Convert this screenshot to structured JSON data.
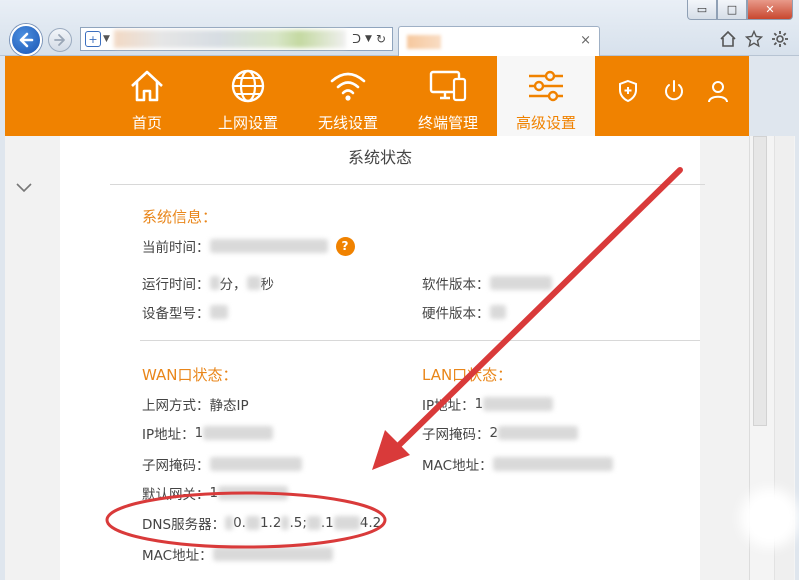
{
  "browser": {
    "window_buttons": {
      "minimize": "▭",
      "maximize": "□",
      "close": "✕"
    },
    "tab_close": "×",
    "icons": [
      "home-icon",
      "star-icon",
      "gear-icon"
    ]
  },
  "nav": {
    "items": [
      {
        "label": "首页",
        "icon": "home-icon"
      },
      {
        "label": "上网设置",
        "icon": "globe-icon"
      },
      {
        "label": "无线设置",
        "icon": "wifi-icon"
      },
      {
        "label": "终端管理",
        "icon": "devices-icon"
      },
      {
        "label": "高级设置",
        "icon": "sliders-icon",
        "active": true
      }
    ],
    "right_icons": [
      "shield-icon",
      "power-icon",
      "user-icon"
    ],
    "color": "#f08200"
  },
  "page": {
    "title": "系统状态",
    "system_info": {
      "title": "系统信息：",
      "current_time_label": "当前时间：",
      "help": "?",
      "uptime_label": "运行时间：",
      "uptime_min": "分，",
      "uptime_sec": "秒",
      "software_version_label": "软件版本：",
      "device_model_label": "设备型号：",
      "hardware_version_label": "硬件版本："
    },
    "wan": {
      "title": "WAN口状态：",
      "conn_type_label": "上网方式：",
      "conn_type_value": "静态IP",
      "ip_label": "IP地址：",
      "ip_prefix": "1",
      "mask_label": "子网掩码：",
      "gateway_label": "默认网关：",
      "gateway_prefix": "1",
      "dns_label": "DNS服务器：",
      "dns_part1": "0.",
      "dns_part2": "1.2",
      "dns_part3": ".5;",
      "dns_part4": ".1",
      "dns_part5": "4.2",
      "mac_label": "MAC地址："
    },
    "lan": {
      "title": "LAN口状态：",
      "ip_label": "IP地址：",
      "ip_prefix": "1",
      "mask_label": "子网掩码：",
      "mask_prefix": "2",
      "mac_label": "MAC地址："
    }
  },
  "annotation": {
    "color": "#d93a3a"
  }
}
